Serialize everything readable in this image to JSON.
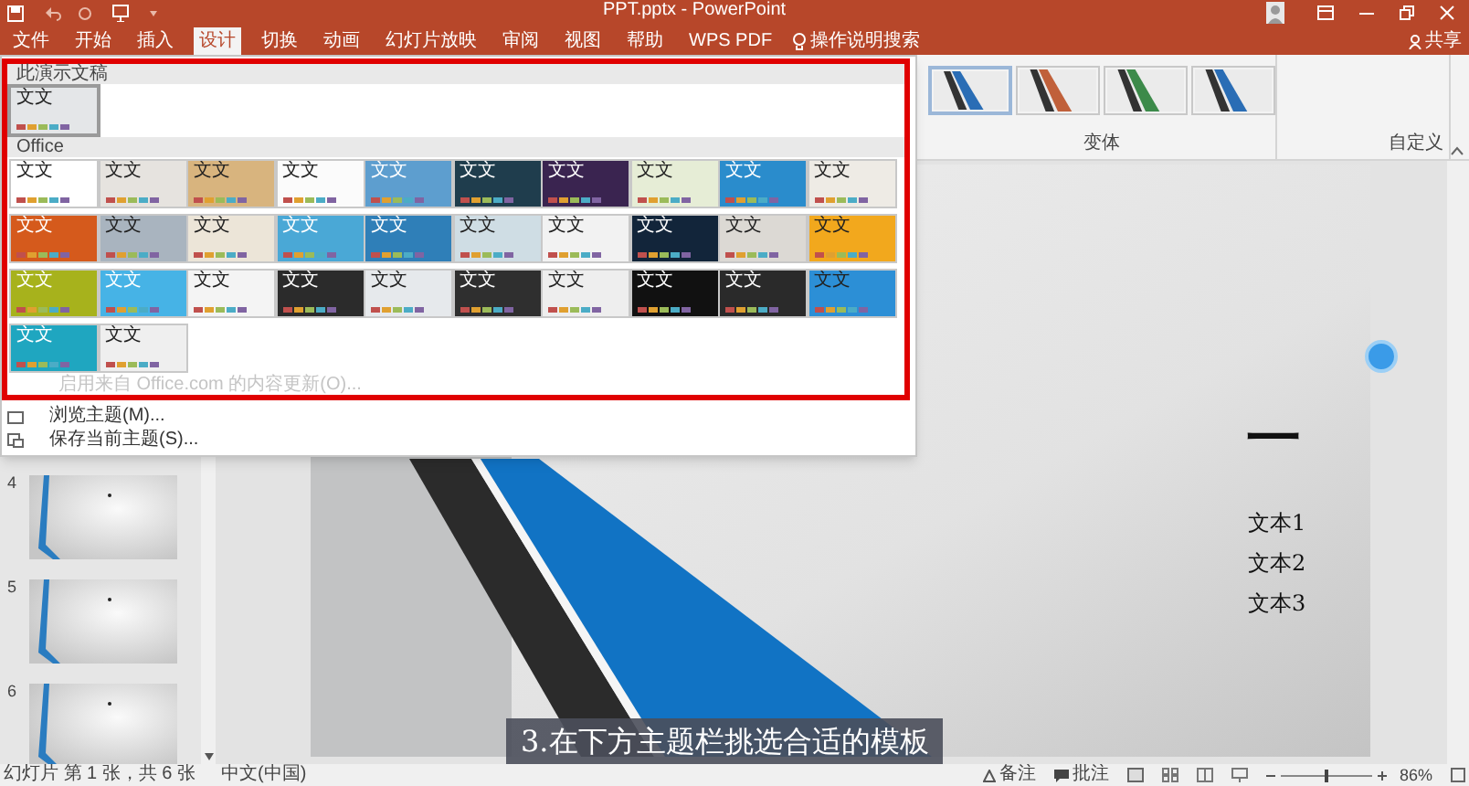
{
  "window": {
    "title": "PPT.pptx - PowerPoint"
  },
  "ribbon_tabs": [
    {
      "label": "文件",
      "selected": false
    },
    {
      "label": "开始",
      "selected": false
    },
    {
      "label": "插入",
      "selected": false
    },
    {
      "label": "设计",
      "selected": true
    },
    {
      "label": "切换",
      "selected": false
    },
    {
      "label": "动画",
      "selected": false
    },
    {
      "label": "幻灯片放映",
      "selected": false
    },
    {
      "label": "审阅",
      "selected": false
    },
    {
      "label": "视图",
      "selected": false
    },
    {
      "label": "帮助",
      "selected": false
    },
    {
      "label": "WPS PDF",
      "selected": false
    }
  ],
  "search": {
    "placeholder": "操作说明搜索"
  },
  "share": {
    "label": "共享"
  },
  "ribbon": {
    "variants": [
      {
        "color": "#2a6db5",
        "selected": true
      },
      {
        "color": "#c0603a",
        "selected": false
      },
      {
        "color": "#3c8a4a",
        "selected": false
      },
      {
        "color": "#2a6db5",
        "selected": false
      }
    ],
    "groups": [
      "变体",
      "自定义"
    ]
  },
  "theme_gallery": {
    "sections": [
      {
        "title": "此演示文稿",
        "themes": [
          {
            "label": "文文",
            "color": "#e4e6e8",
            "kind": "light",
            "selected": true
          }
        ]
      },
      {
        "title": "Office",
        "themes": [
          {
            "label": "文文",
            "color": "#ffffff",
            "kind": "light",
            "selected": false
          },
          {
            "label": "文文",
            "color": "#e6e3df",
            "kind": "light",
            "selected": false
          },
          {
            "label": "文文",
            "color": "#d8b47e",
            "kind": "light",
            "selected": false
          },
          {
            "label": "文文",
            "color": "#fbfbfb",
            "kind": "light",
            "selected": false
          },
          {
            "label": "文文",
            "color": "#5d9ecf",
            "kind": "dark",
            "selected": false
          },
          {
            "label": "文文",
            "color": "#1f3d4d",
            "kind": "dark",
            "selected": false
          },
          {
            "label": "文文",
            "color": "#3a2450",
            "kind": "dark",
            "selected": false
          },
          {
            "label": "文文",
            "color": "#e6edd6",
            "kind": "light",
            "selected": false
          },
          {
            "label": "文文",
            "color": "#2a8ccc",
            "kind": "dark",
            "selected": false
          },
          {
            "label": "文文",
            "color": "#eeebe5",
            "kind": "light",
            "selected": false
          },
          {
            "label": "文文",
            "color": "#d55a1c",
            "kind": "dark",
            "selected": false
          },
          {
            "label": "文文",
            "color": "#a9b4bf",
            "kind": "light",
            "selected": false
          },
          {
            "label": "文文",
            "color": "#ece5d8",
            "kind": "light",
            "selected": false
          },
          {
            "label": "文文",
            "color": "#4aa8d6",
            "kind": "dark",
            "selected": false
          },
          {
            "label": "文文",
            "color": "#2f7fb8",
            "kind": "dark",
            "selected": false
          },
          {
            "label": "文文",
            "color": "#cfdde4",
            "kind": "light",
            "selected": false
          },
          {
            "label": "文文",
            "color": "#f2f2f2",
            "kind": "light",
            "selected": false
          },
          {
            "label": "文文",
            "color": "#12253a",
            "kind": "dark",
            "selected": false
          },
          {
            "label": "文文",
            "color": "#dcd9d4",
            "kind": "light",
            "selected": false
          },
          {
            "label": "文文",
            "color": "#f2a81d",
            "kind": "light",
            "selected": false
          },
          {
            "label": "文文",
            "color": "#a7b21c",
            "kind": "dark",
            "selected": false
          },
          {
            "label": "文文",
            "color": "#46b3e6",
            "kind": "dark",
            "selected": false
          },
          {
            "label": "文文",
            "color": "#f4f4f4",
            "kind": "light",
            "selected": false
          },
          {
            "label": "文文",
            "color": "#2b2b2b",
            "kind": "dark",
            "selected": false
          },
          {
            "label": "文文",
            "color": "#e6e9ec",
            "kind": "light",
            "selected": false
          },
          {
            "label": "文文",
            "color": "#2f2f2f",
            "kind": "dark",
            "selected": false
          },
          {
            "label": "文文",
            "color": "#eeeeee",
            "kind": "light",
            "selected": false
          },
          {
            "label": "文文",
            "color": "#111111",
            "kind": "dark",
            "selected": false
          },
          {
            "label": "文文",
            "color": "#2a2a2a",
            "kind": "dark",
            "selected": false
          },
          {
            "label": "文文",
            "color": "#2c8fd6",
            "kind": "light",
            "selected": false
          },
          {
            "label": "文文",
            "color": "#1fa6c0",
            "kind": "dark",
            "selected": false
          },
          {
            "label": "文文",
            "color": "#efefef",
            "kind": "light",
            "selected": false
          }
        ]
      }
    ],
    "update_option": {
      "label": "启用来自 Office.com 的内容更新(O)...",
      "disabled": true
    },
    "menu_items": [
      "浏览主题(M)...",
      "保存当前主题(S)..."
    ]
  },
  "slides_panel": {
    "slides": [
      {
        "number": "4"
      },
      {
        "number": "5"
      },
      {
        "number": "6"
      }
    ]
  },
  "slide": {
    "title": "一",
    "bullets": [
      "文本1",
      "文本2",
      "文本3"
    ]
  },
  "caption": "3.在下方主题栏挑选合适的模板",
  "status_bar": {
    "slide_info": "幻灯片 第 1 张，共 6 张",
    "language": "中文(中国)",
    "notes": "备注",
    "comments": "批注",
    "zoom": {
      "level": 0.5,
      "reading": "86%"
    }
  }
}
